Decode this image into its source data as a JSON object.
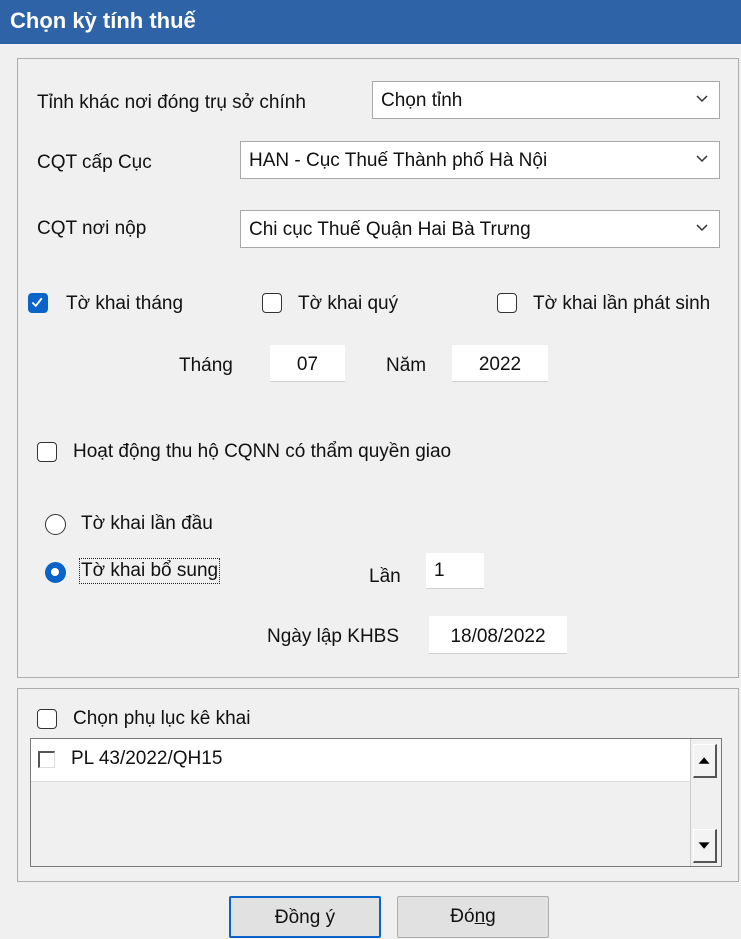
{
  "window": {
    "title": "Chọn kỳ tính thuế"
  },
  "form": {
    "province_label": "Tỉnh khác nơi đóng trụ sở chính",
    "province_value": "Chọn tỉnh",
    "cqt_cuc_label": "CQT cấp Cục",
    "cqt_cuc_value": "HAN - Cục Thuế Thành phố Hà Nội",
    "cqt_noi_nop_label": "CQT nơi nộp",
    "cqt_noi_nop_value": "Chi cục Thuế Quận Hai Bà Trưng",
    "period_options": [
      {
        "label": "Tờ khai tháng",
        "checked": true
      },
      {
        "label": "Tờ khai quý",
        "checked": false
      },
      {
        "label": "Tờ khai lần phát sinh",
        "checked": false
      }
    ],
    "month_label": "Tháng",
    "month_value": "07",
    "year_label": "Năm",
    "year_value": "2022",
    "collection_label": "Hoạt động thu hộ CQNN có thẩm quyền giao",
    "collection_checked": false,
    "declaration_types": [
      {
        "label": "Tờ khai lần đầu",
        "selected": false
      },
      {
        "label": "Tờ khai bổ sung",
        "selected": true
      }
    ],
    "times_label": "Lần",
    "times_value": "1",
    "khbs_date_label": "Ngày lập KHBS",
    "khbs_date_value": "18/08/2022"
  },
  "appendix": {
    "label": "Chọn phụ lục kê khai",
    "checked": false,
    "items": [
      {
        "label": "PL 43/2022/QH15",
        "checked": false
      }
    ]
  },
  "buttons": {
    "ok_pre": "Đồn",
    "ok_accel": "g",
    "ok_post": " ý",
    "close_pre": "Đó",
    "close_accel": "n",
    "close_post": "g"
  },
  "colors": {
    "title_bar": "#2e63a8",
    "accent": "#0a63c9"
  },
  "icons": {
    "dropdown": "chevron-down-icon",
    "scroll_up": "arrow-up-icon",
    "scroll_down": "arrow-down-icon"
  }
}
